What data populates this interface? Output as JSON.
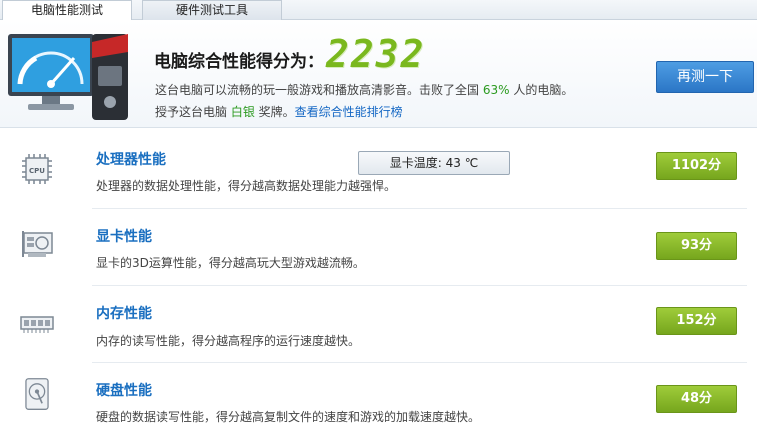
{
  "tabs": [
    {
      "label": "电脑性能测试"
    },
    {
      "label": "硬件测试工具"
    }
  ],
  "header": {
    "score_title": "电脑综合性能得分为：",
    "score": "2232",
    "line1_prefix": "这台电脑可以流畅的玩一般游戏和播放高清影音。击败了全国 ",
    "line1_pct": "63%",
    "line1_suffix": " 人的电脑。",
    "line2_prefix": "授予这台电脑 ",
    "line2_medal": "白银",
    "line2_mid": " 奖牌。",
    "line2_link": "查看综合性能排行榜",
    "retest_label": "再测一下"
  },
  "gpu_temp": "显卡温度: 43 ℃",
  "rows": [
    {
      "name": "处理器性能",
      "desc": "处理器的数据处理性能，得分越高数据处理能力越强悍。",
      "score": "1102分",
      "icon": "cpu-icon"
    },
    {
      "name": "显卡性能",
      "desc": "显卡的3D运算性能，得分越高玩大型游戏越流畅。",
      "score": "93分",
      "icon": "graphics-card-icon"
    },
    {
      "name": "内存性能",
      "desc": "内存的读写性能，得分越高程序的运行速度越快。",
      "score": "152分",
      "icon": "memory-icon"
    },
    {
      "name": "硬盘性能",
      "desc": "硬盘的数据读写性能，得分越高复制文件的速度和游戏的加载速度越快。",
      "score": "48分",
      "icon": "hard-disk-icon"
    }
  ],
  "colors": {
    "accent_blue": "#2b76c6",
    "score_green": "#7ab81e",
    "pill_green": "#8ab82b",
    "title_blue": "#1a6fc0"
  }
}
